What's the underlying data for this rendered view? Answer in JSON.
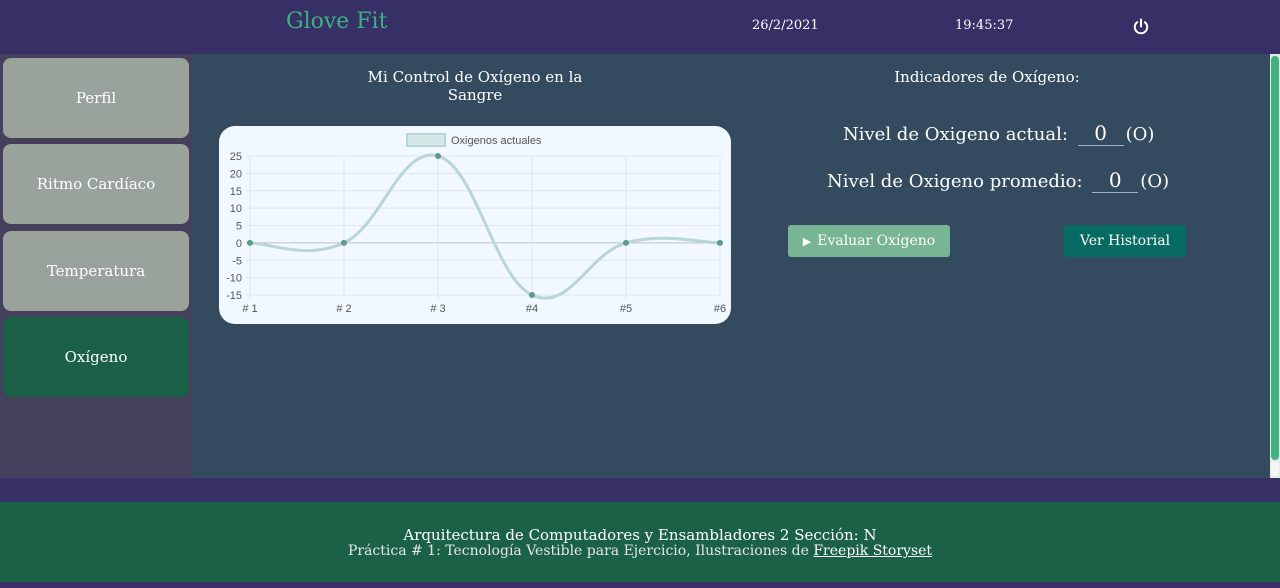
{
  "header": {
    "brand": "Glove Fit",
    "date": "26/2/2021",
    "time": "19:45:37",
    "power_icon": "power-icon"
  },
  "sidebar": {
    "items": [
      {
        "label": "Perfil",
        "active": false
      },
      {
        "label": "Ritmo Cardíaco",
        "active": false
      },
      {
        "label": "Temperatura",
        "active": false
      },
      {
        "label": "Oxígeno",
        "active": true
      }
    ]
  },
  "main": {
    "chart_title": "Mi Control de Oxígeno en la Sangre",
    "indicators": {
      "title": "Indicadores de Oxígeno:",
      "current_label": "Nivel de Oxigeno actual:",
      "current_value": "0",
      "current_unit": "(O)",
      "avg_label": "Nivel de Oxigeno promedio:",
      "avg_value": "0",
      "avg_unit": "(O)"
    },
    "buttons": {
      "evaluate": "Evaluar Oxígeno",
      "evaluate_icon": "play-icon",
      "history": "Ver Historial"
    }
  },
  "chart_data": {
    "type": "line",
    "categories": [
      "# 1",
      "# 2",
      "# 3",
      "#4",
      "#5",
      "#6"
    ],
    "series": [
      {
        "name": "Oxigenos actuales",
        "values": [
          0,
          0,
          25,
          -15,
          0,
          0
        ]
      }
    ],
    "yticks": [
      25,
      20,
      15,
      10,
      5,
      0,
      -5,
      -10,
      -15
    ],
    "ylim": [
      -15,
      25
    ],
    "legend": "top",
    "grid": true,
    "colors": {
      "line": "#b9d5d6",
      "point": "#5e9b8c"
    }
  },
  "footer": {
    "line1": "Arquitectura de Computadores y Ensambladores 2 Sección: N",
    "line2_prefix": "Práctica # 1: Tecnología Vestible para Ejercicio, Ilustraciones de ",
    "link": "Freepik Storyset"
  },
  "colors": {
    "header_bg": "#363066",
    "brand": "#3fb07f",
    "main_bg": "#344a5e",
    "active_nav": "#1a6147",
    "nav": "#9aa29c",
    "footer_bg": "#1b6146",
    "eval_button": "#77b595",
    "history_button": "#076a63"
  }
}
